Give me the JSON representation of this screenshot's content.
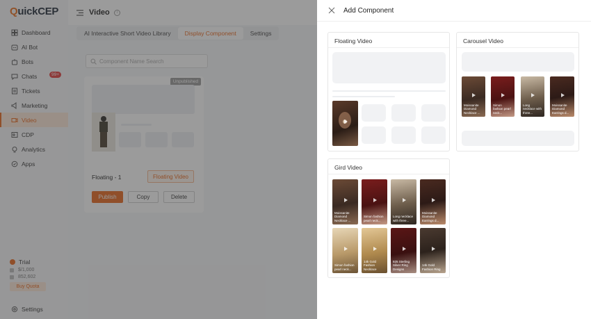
{
  "app": {
    "logo_q": "Q",
    "logo_rest": "uickCEP",
    "header_title": "Video",
    "info_icon": "i"
  },
  "sidebar": {
    "items": [
      {
        "label": "Dashboard",
        "icon": "dashboard-icon"
      },
      {
        "label": "AI Bot",
        "icon": "ai-bot-icon"
      },
      {
        "label": "Bots",
        "icon": "bots-icon"
      },
      {
        "label": "Chats",
        "icon": "chats-icon",
        "badge": "99+"
      },
      {
        "label": "Tickets",
        "icon": "tickets-icon"
      },
      {
        "label": "Marketing",
        "icon": "marketing-icon"
      },
      {
        "label": "Video",
        "icon": "video-icon",
        "active": true
      },
      {
        "label": "CDP",
        "icon": "cdp-icon"
      },
      {
        "label": "Analytics",
        "icon": "analytics-icon"
      },
      {
        "label": "Apps",
        "icon": "apps-icon"
      }
    ],
    "trial": {
      "title": "Trial",
      "row1": "$/1,000",
      "row2": "852,602",
      "buy_label": "Buy Quota"
    },
    "settings_label": "Settings"
  },
  "main": {
    "tabs": [
      {
        "label": "AI Interactive Short Video Library"
      },
      {
        "label": "Display Component",
        "active": true
      },
      {
        "label": "Settings"
      }
    ],
    "search_placeholder": "Component Name Search",
    "card": {
      "status": "Unpublished",
      "name": "Floating - 1",
      "type": "Floating Video",
      "publish_label": "Publish",
      "copy_label": "Copy",
      "delete_label": "Delete"
    }
  },
  "drawer": {
    "title": "Add Component",
    "panels": {
      "floating": {
        "title": "Floating Video"
      },
      "carousel": {
        "title": "Carousel Video",
        "items": [
          {
            "caption": "Moissanite Diamond Necklace ..."
          },
          {
            "caption": "Simon fashion pearl neck..."
          },
          {
            "caption": "Long necklace with three..."
          },
          {
            "caption": "Moissanite Diamond Earrings d..."
          }
        ]
      },
      "grid": {
        "title": "Gird Video",
        "items": [
          {
            "caption": "Moissanite Diamond Necklace ..."
          },
          {
            "caption": "Simon fashion pearl neck..."
          },
          {
            "caption": "Long necklace with three..."
          },
          {
            "caption": "Moissanite Diamond Earrings d..."
          },
          {
            "caption": "Simon fashion pearl neck..."
          },
          {
            "caption": "14k Gold Fashion Necklace"
          },
          {
            "caption": "925 Sterling Silver Ring Designs"
          },
          {
            "caption": "14k Gold Fashion Ring"
          }
        ]
      }
    }
  },
  "colors": {
    "accent": "#e8661c",
    "badge": "#e23c3c"
  }
}
